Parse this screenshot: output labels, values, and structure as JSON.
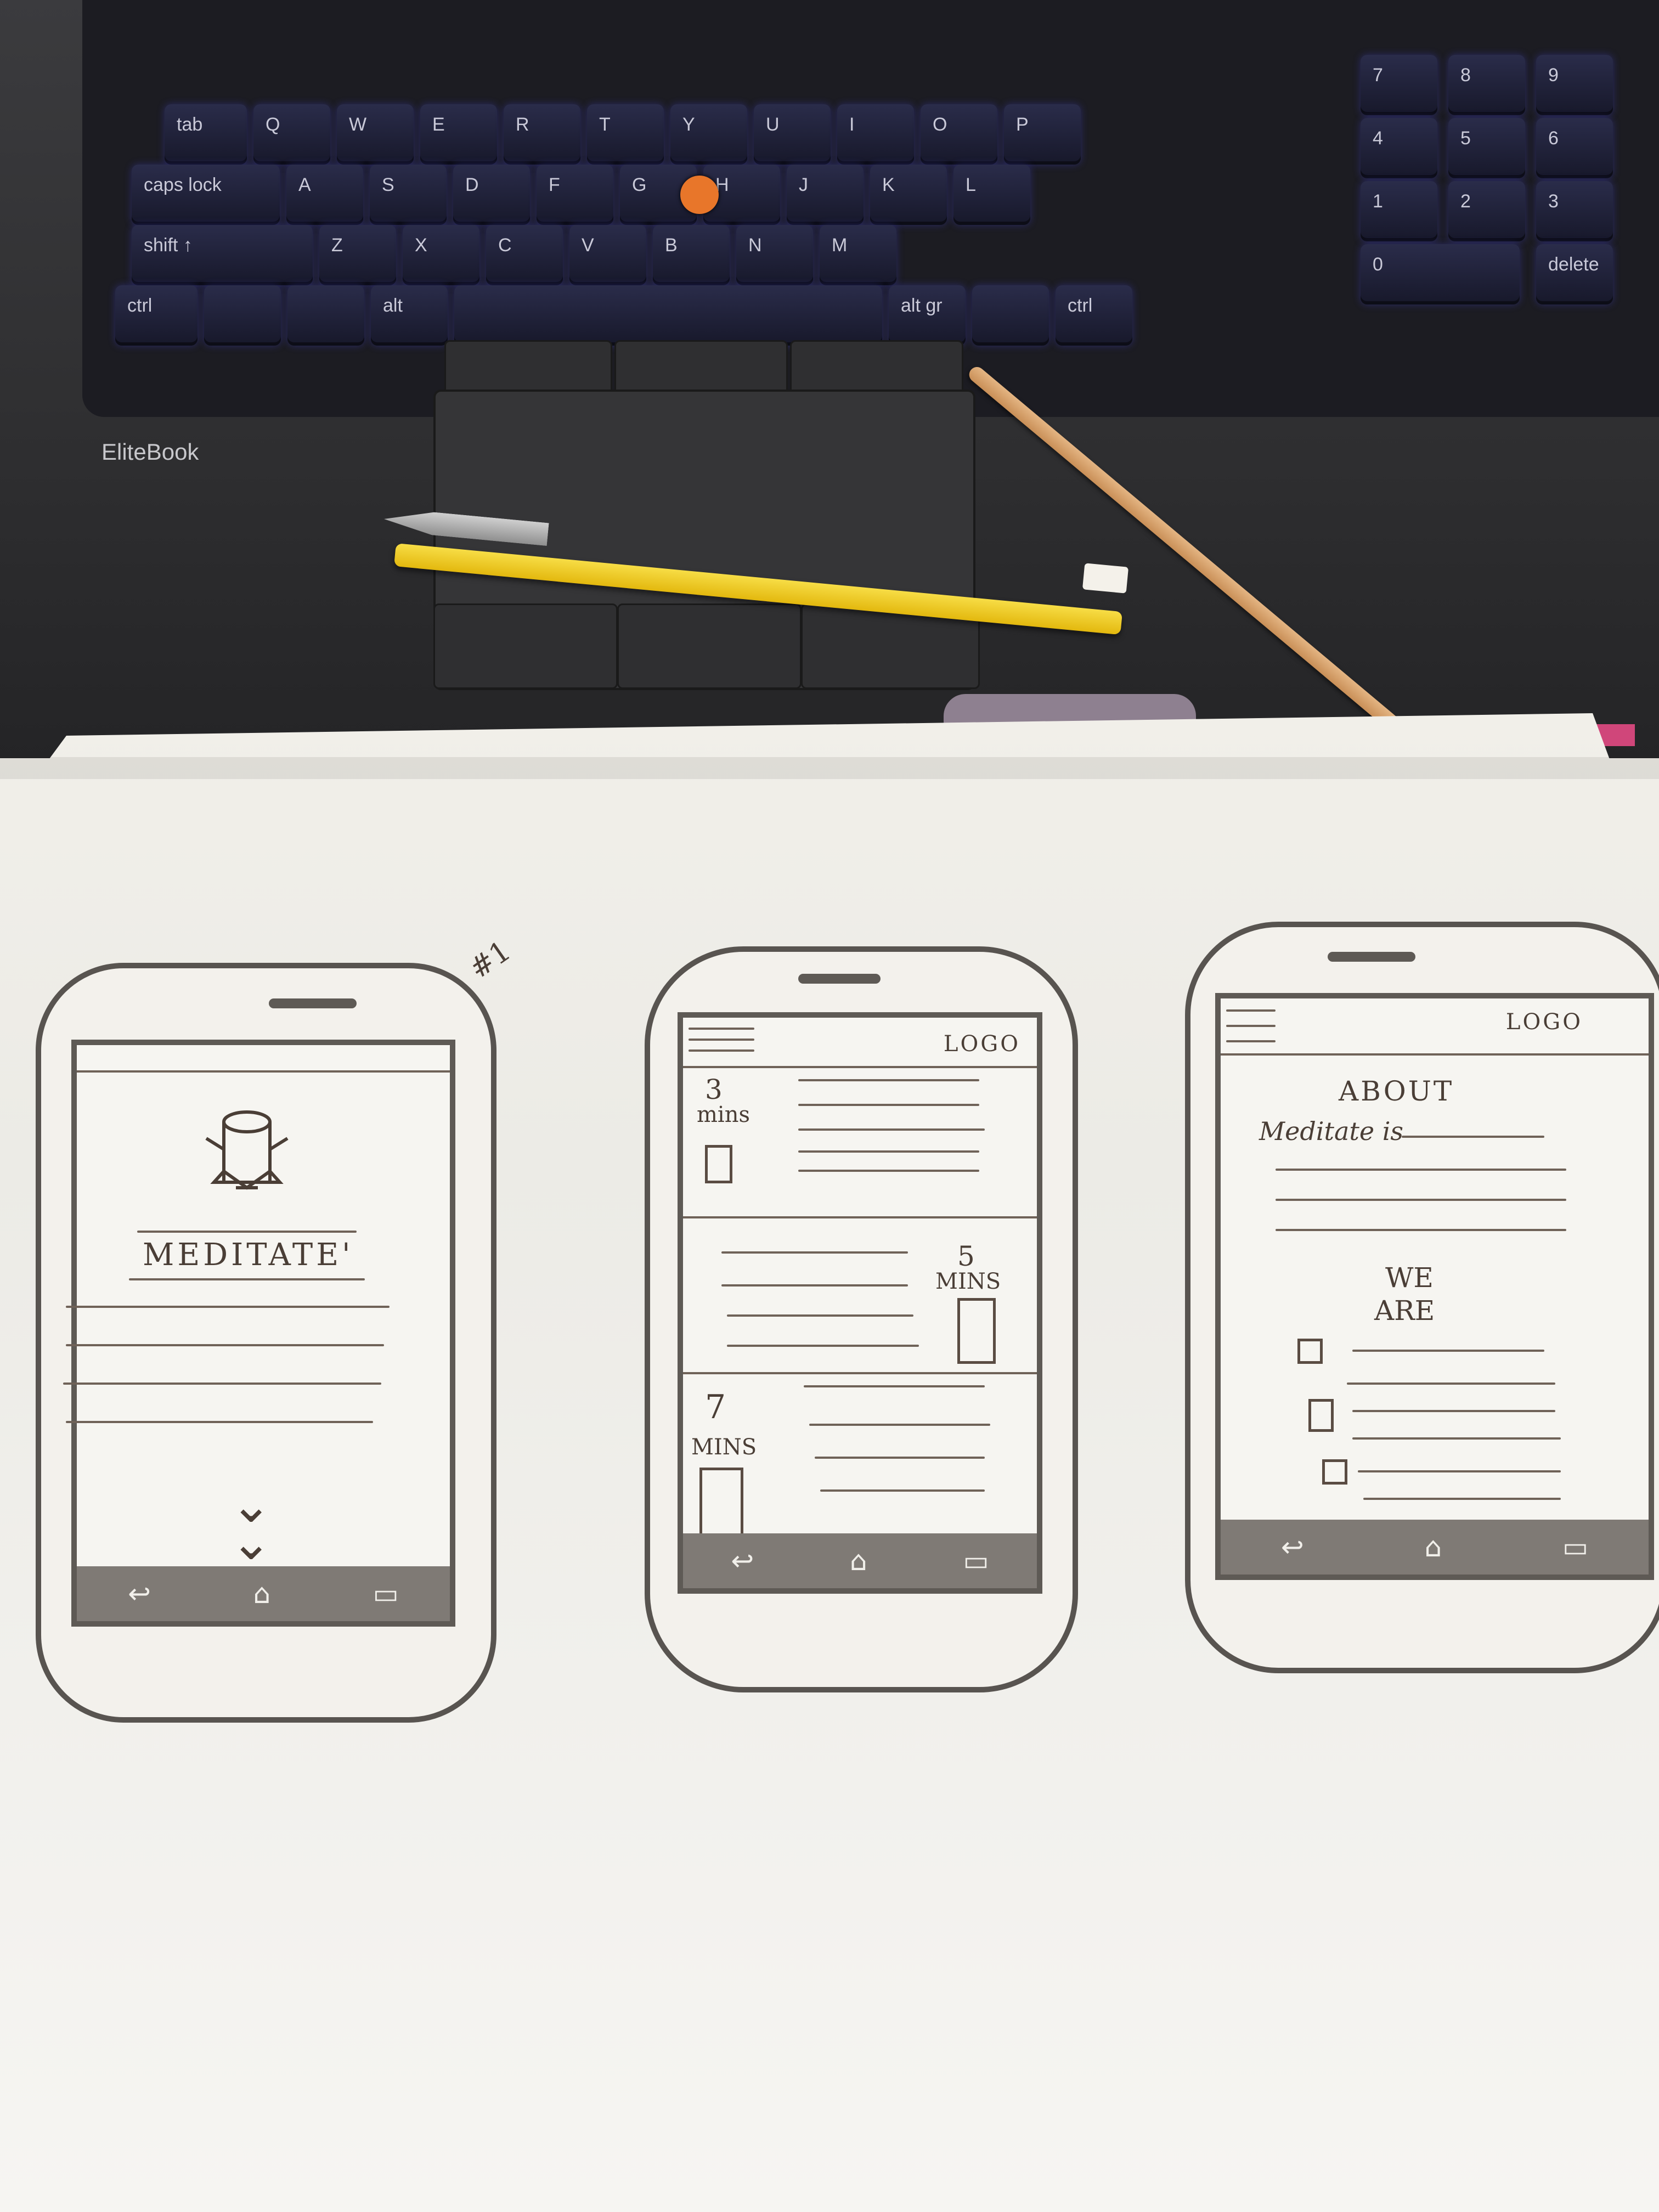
{
  "laptop": {
    "brand": "EliteBook",
    "keys_row1": [
      "tab",
      "Q",
      "W",
      "E",
      "R",
      "T",
      "Y",
      "U",
      "I",
      "O",
      "P"
    ],
    "keys_row2": [
      "caps lock",
      "A",
      "S",
      "D",
      "F",
      "G",
      "H",
      "J",
      "K",
      "L"
    ],
    "keys_row3": [
      "shift ↑",
      "Z",
      "X",
      "C",
      "V",
      "B",
      "N",
      "M"
    ],
    "keys_row4": [
      "ctrl",
      "",
      "",
      "alt",
      "",
      "alt gr",
      "",
      "ctrl"
    ],
    "numpad": [
      "7",
      "8",
      "9",
      "4",
      "5",
      "6",
      "1",
      "2",
      "3",
      "0",
      "delete"
    ]
  },
  "sketch": {
    "page_number": "#1",
    "screen1": {
      "title": "MEDITATE'",
      "nav_icons": [
        "↩",
        "⌂",
        "▭"
      ]
    },
    "screen2": {
      "logo": "LOGO",
      "sessions": [
        {
          "num": "3",
          "unit": "mins"
        },
        {
          "num": "5",
          "unit": "MINS"
        },
        {
          "num": "7",
          "unit": "MINS"
        }
      ],
      "nav_icons": [
        "↩",
        "⌂",
        "▭"
      ]
    },
    "screen3": {
      "logo": "LOGO",
      "heading": "ABOUT",
      "intro": "Meditate is",
      "subheading_line1": "WE",
      "subheading_line2": "ARE",
      "nav_icons": [
        "↩",
        "⌂",
        "▭"
      ]
    }
  }
}
